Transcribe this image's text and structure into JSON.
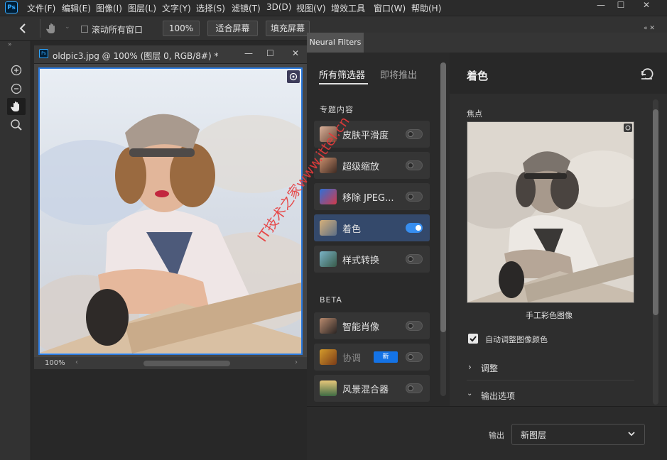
{
  "app": {
    "logo": "Ps",
    "menu": [
      "文件(F)",
      "编辑(E)",
      "图像(I)",
      "图层(L)",
      "文字(Y)",
      "选择(S)",
      "滤镜(T)",
      "3D(D)",
      "视图(V)",
      "增效工具",
      "窗口(W)",
      "帮助(H)"
    ],
    "window_controls": [
      "—",
      "☐",
      "✕"
    ]
  },
  "options_bar": {
    "scroll_all_label": "滚动所有窗口",
    "zoom_value": "100%",
    "fit_screen_label": "适合屏幕",
    "fill_screen_label": "填充屏幕"
  },
  "tools": {
    "icons": [
      "zoom-in-icon",
      "zoom-out-icon",
      "hand-icon",
      "magnifier-icon"
    ]
  },
  "document": {
    "title": "oldpic3.jpg @ 100% (图层 0, RGB/8#) *",
    "zoom_status": "100%"
  },
  "neural_filters": {
    "panel_tab": "Neural Filters",
    "list_tabs": [
      "所有筛选器",
      "即将推出"
    ],
    "section_featured": "专题内容",
    "section_beta": "BETA",
    "featured_filters": [
      {
        "label": "皮肤平滑度",
        "on": false
      },
      {
        "label": "超级缩放",
        "on": false
      },
      {
        "label": "移除 JPEG...",
        "on": false
      },
      {
        "label": "着色",
        "on": true
      },
      {
        "label": "样式转换",
        "on": false
      }
    ],
    "beta_filters": [
      {
        "label": "智能肖像",
        "on": false
      },
      {
        "label": "协调",
        "on": false,
        "badge": "新"
      },
      {
        "label": "风景混合器",
        "on": false
      }
    ],
    "detail": {
      "title": "着色",
      "focus_label": "焦点",
      "preview_caption": "手工彩色图像",
      "auto_adjust_label": "自动调整图像颜色",
      "auto_adjust_checked": true,
      "adjust_label": "调整",
      "output_options_label": "输出选项"
    },
    "footer": {
      "output_label": "输出",
      "output_value": "新图层"
    }
  },
  "watermark": "IT技术之家www.ittel.cn"
}
